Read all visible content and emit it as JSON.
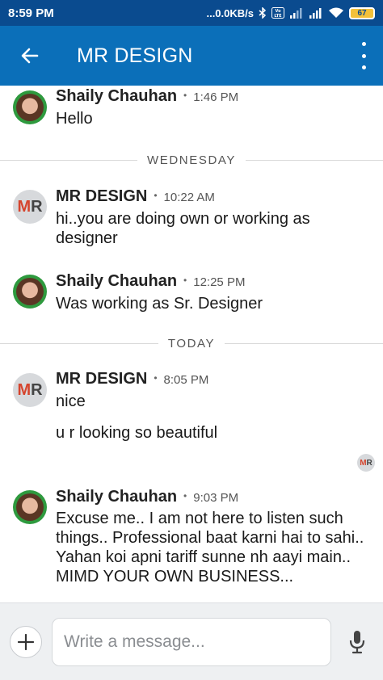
{
  "status_bar": {
    "time": "8:59 PM",
    "network_speed": "...0.0KB/s",
    "battery": "67",
    "icons": [
      "bluetooth-icon",
      "volte-icon",
      "signal-icon",
      "signal-icon",
      "wifi-icon",
      "battery-icon"
    ]
  },
  "app_bar": {
    "title": "MR DESIGN",
    "back_icon": "arrow-left-icon",
    "menu_icon": "more-vertical-icon",
    "colors": {
      "status": "#0a4b8f",
      "bar": "#0b6fb9"
    }
  },
  "messages": [
    {
      "sender": "Shaily Chauhan",
      "time": "1:46 PM",
      "text": "Hello",
      "avatar": "photo"
    },
    {
      "divider": "WEDNESDAY"
    },
    {
      "sender": "MR DESIGN",
      "time": "10:22 AM",
      "text": "hi..you are doing own or working as designer",
      "avatar": "MR"
    },
    {
      "sender": "Shaily Chauhan",
      "time": "12:25 PM",
      "text": "Was working as Sr. Designer",
      "avatar": "photo"
    },
    {
      "divider": "TODAY"
    },
    {
      "sender": "MR DESIGN",
      "time": "8:05 PM",
      "text": "nice",
      "text2": "u r looking so beautiful",
      "avatar": "MR"
    },
    {
      "sender": "Shaily Chauhan",
      "time": "9:03 PM",
      "text": "Excuse me.. I am not here to listen such things.. Professional baat karni hai to sahi.. Yahan koi apni tariff sunne nh aayi main.. MIMD YOUR OWN BUSINESS...",
      "avatar": "photo"
    }
  ],
  "avatar_initials": {
    "m": "M",
    "r": "R"
  },
  "composer": {
    "placeholder": "Write a message...",
    "add_icon": "plus-icon",
    "mic_icon": "microphone-icon"
  }
}
